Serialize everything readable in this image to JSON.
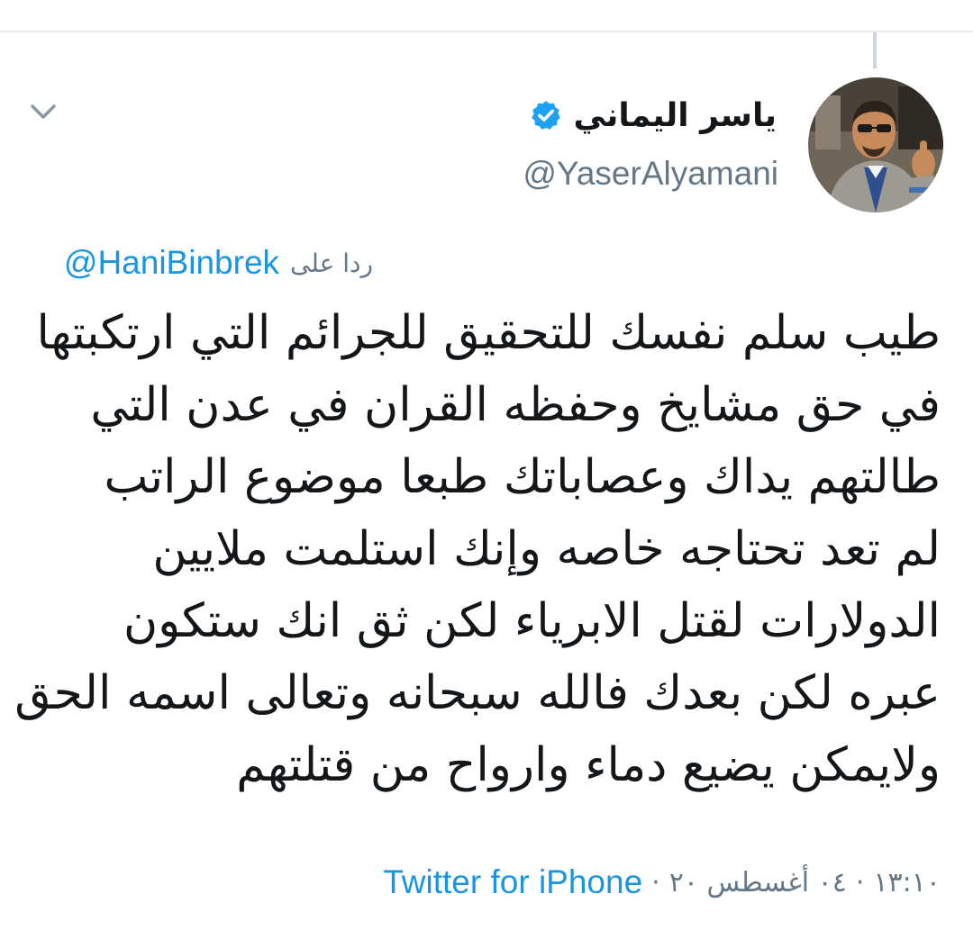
{
  "tweet": {
    "author": {
      "display_name": "ياسر اليماني",
      "handle": "@YaserAlyamani",
      "verified": true,
      "avatar_icon": "profile-photo"
    },
    "reply": {
      "prefix": "ردا على",
      "to_handle": "@HaniBinbrek"
    },
    "body_lines": [
      "طيب سلم نفسك للتحقيق للجرائم التي ارتكبتها",
      "في حق مشايخ وحفظه القران في عدن التي",
      "طالتهم يداك وعصاباتك طبعا موضوع الراتب",
      "لم تعد تحتاجه خاصه وإنك استلمت ملايين",
      "الدولارات لقتل الابرياء لكن ثق انك ستكون",
      "عبره لكن بعدك فالله سبحانه وتعالى اسمه الحق",
      "ولايمكن يضيع دماء وارواح من قتلتهم"
    ],
    "meta": {
      "time": "١٣:١٠",
      "date": "٠٤ أغسطس ٢٠",
      "separator": "·",
      "source": "Twitter for iPhone"
    }
  },
  "icons": {
    "menu": "chevron-down-icon",
    "verified": "verified-badge-icon"
  },
  "colors": {
    "link": "#1b95e0",
    "secondary_text": "#657786",
    "primary_text": "#14171a",
    "verified_badge": "#1da1f2",
    "divider": "#e6ecf0"
  }
}
